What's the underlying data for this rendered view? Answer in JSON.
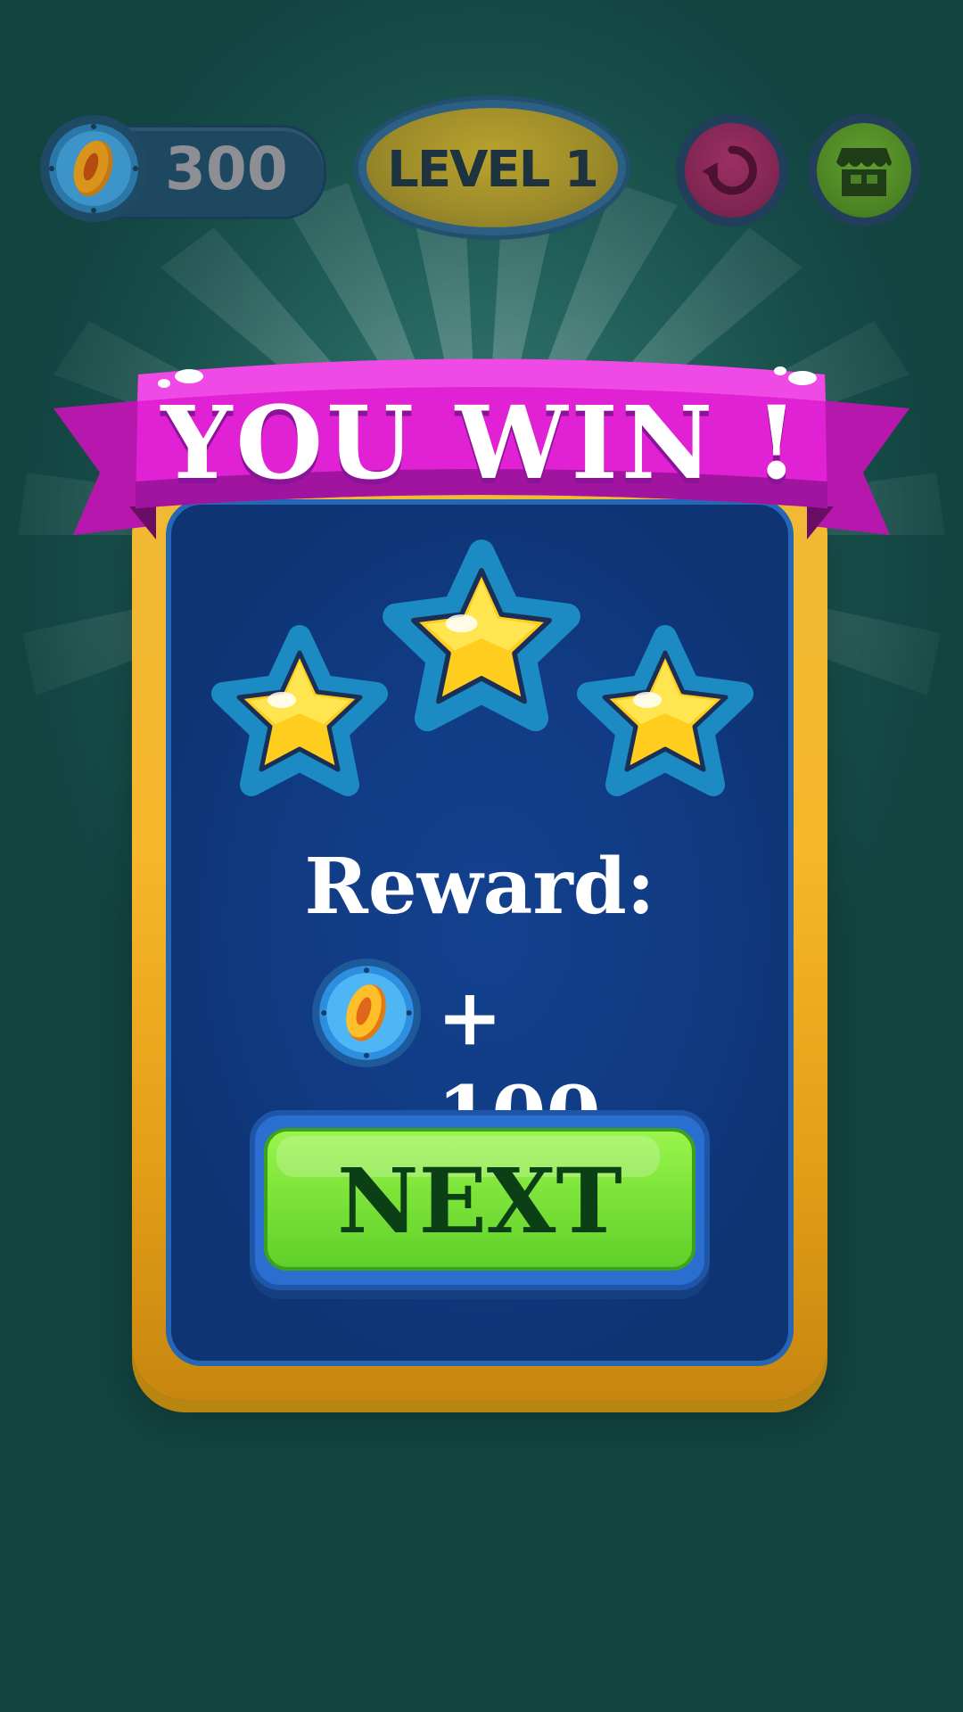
{
  "hud": {
    "coins": "300",
    "level_label": "LEVEL 1",
    "restart_icon": "restart-icon",
    "shop_icon": "shop-icon"
  },
  "result": {
    "title": "YOU WIN !",
    "stars_earned": 3,
    "stars_total": 3,
    "reward_label": "Reward:",
    "reward_amount": "+ 100",
    "next_label": "NEXT"
  },
  "colors": {
    "background": "#1d5753",
    "ribbon": "#e21fd6",
    "panel_frame": "#f5b22a",
    "panel_inner": "#123f8a",
    "next_button": "#7ee43a",
    "star": "#ffd52b"
  }
}
